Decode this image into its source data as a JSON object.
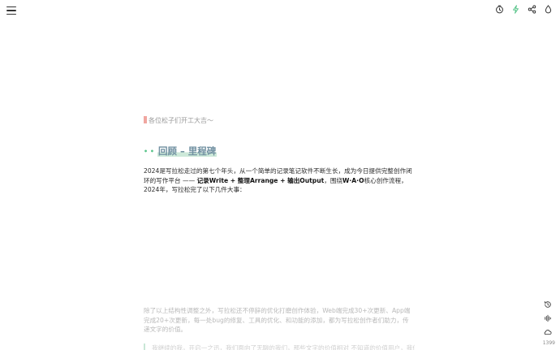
{
  "colors": {
    "accent_green": "#58c48a",
    "heading_text": "#6f8fa0",
    "highlight": "#cde9d9",
    "greeting_bar": "#f0a6a0"
  },
  "toolbar": {
    "menu_icon": "hamburger-icon",
    "icons": [
      "clock-icon",
      "lightning-icon",
      "share-icon",
      "ink-drop-icon"
    ]
  },
  "document": {
    "greeting": "各位松子们开工大吉～",
    "heading_prefix": "• •",
    "heading": "回顾 – 里程碑",
    "paragraph": {
      "p1": "2024是写拉松走过的第七个年头，从一个简单的记录笔记软件不断生长，成为今日提供完整创作闭环的写作平台 —— ",
      "b1": "记录Write + 整理Arrange + 输出Output",
      "p2": "，围绕",
      "b2": "W·A·O",
      "p3": "核心创作流程，2024年，写拉松完了以下几件大事："
    },
    "faded_paragraph": "除了以上结构性调整之外，写拉松还不停辞的优化打磨创作体验，Web端完成30+次更新、App端完成20+次更新，每一处bug的修复、工具的优化、和功能的添加，都为写拉松创作者们助力，传递文字的价值。",
    "quote": "我继续的我，开启一之迅，我们面向了无聊的我们，那些文字的价值相对 不知道的价值用户，我们"
  },
  "sidebar": {
    "icons": [
      "history-icon",
      "audio-wave-icon",
      "cloud-icon"
    ],
    "word_count": "1399"
  }
}
